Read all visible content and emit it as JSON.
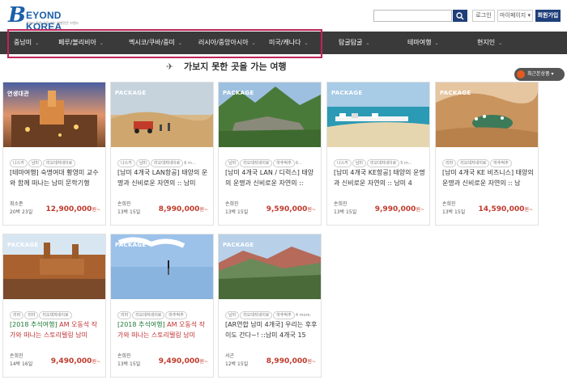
{
  "header": {
    "logo_text": "EYOND KOREA",
    "logo_letter": "B",
    "logo_sub": "가보지 못한 곳을 가는 여행전문 브랜드",
    "login": "로그인",
    "mypage": "마이페이지 ▾",
    "join": "회원가입"
  },
  "nav": {
    "items": [
      "중남미",
      "페루/볼리비아",
      "멕시코/쿠바/중미",
      "러시아/중앙아시아",
      "미국/캐나다",
      "탐굴탐굴",
      "테마여행",
      "현지인"
    ],
    "recent": "최근본상품 ▾"
  },
  "section_title": "가보지 못한 곳을 가는 여행",
  "cards": [
    {
      "badge": "연생대관",
      "tags": [
        "나스카",
        "남미",
        "리오데자네이로"
      ],
      "more": "",
      "title_a": "[테마여행] 숙명여대 황영미 교수와 함께 떠나는 남미 문학기행",
      "title_b": "",
      "author": "최소준",
      "period": "20박 23일",
      "price": "12,900,000",
      "won": "원~"
    },
    {
      "badge": "PACKAGE",
      "tags": [
        "나스카",
        "남미",
        "리오데자네이로"
      ],
      "more": "6 m...",
      "title_a": "[남미 4개국 LAN항공] 태양의 운명과 신비로운 자연의 :: 남미",
      "title_b": "",
      "author": "손희진",
      "period": "13박 15일",
      "price": "8,990,000",
      "won": "원~"
    },
    {
      "badge": "PACKAGE",
      "tags": [
        "남미",
        "리오데자네이로",
        "마추픽추"
      ],
      "more": "6...",
      "title_a": "[남미 4개국 LAN / 디럭스] 태양의 운명과 신비로운 자연의 ::",
      "title_b": "",
      "author": "손희진",
      "period": "13박 15일",
      "price": "9,590,000",
      "won": "원~"
    },
    {
      "badge": "PACKAGE",
      "tags": [
        "나스카",
        "남미",
        "리오데자네이로"
      ],
      "more": "5 m...",
      "title_a": "[남미 4개국 KE항공] 태양의 운명과 신비로운 자연의 :: 남미 4",
      "title_b": "",
      "author": "손희진",
      "period": "13박 15일",
      "price": "9,990,000",
      "won": "원~"
    },
    {
      "badge": "PACKAGE",
      "tags": [
        "리마",
        "리오데자네이로",
        "마추픽추"
      ],
      "more": "",
      "title_a": "[남미 4개국 KE 비즈니스] 태양의 운명과 신비로운 자연의 :: 남",
      "title_b": "",
      "author": "손희진",
      "period": "13박 15일",
      "price": "14,590,000",
      "won": "원~"
    },
    {
      "badge": "PACKAGE",
      "tags": [
        "리마",
        "리마",
        "리오데자네이로"
      ],
      "more": "",
      "title_a": "[2018 추석여행]",
      "title_b": " AM 오동석 작가와 떠나는 스토리텔링 남미",
      "author": "손희진",
      "period": "14박 16일",
      "price": "9,490,000",
      "won": "원~"
    },
    {
      "badge": "PACKAGE",
      "tags": [
        "리마",
        "리오데자네이로",
        "마추픽추"
      ],
      "more": "",
      "title_a": "[2018 추석여행]",
      "title_b": " AM 오동석 작가와 떠나는 스토리텔링 남미",
      "author": "손희진",
      "period": "13박 15일",
      "price": "9,490,000",
      "won": "원~"
    },
    {
      "badge": "PACKAGE",
      "tags": [
        "남미",
        "리오데자네이로",
        "마추픽추"
      ],
      "more": "4 more.",
      "title_a": "[AR연합 남미 4개국] 우리는 후후이도 간다~! ::남미 4개국 15",
      "title_b": "",
      "author": "서곤",
      "period": "12박 15일",
      "price": "8,990,000",
      "won": "원~"
    }
  ]
}
